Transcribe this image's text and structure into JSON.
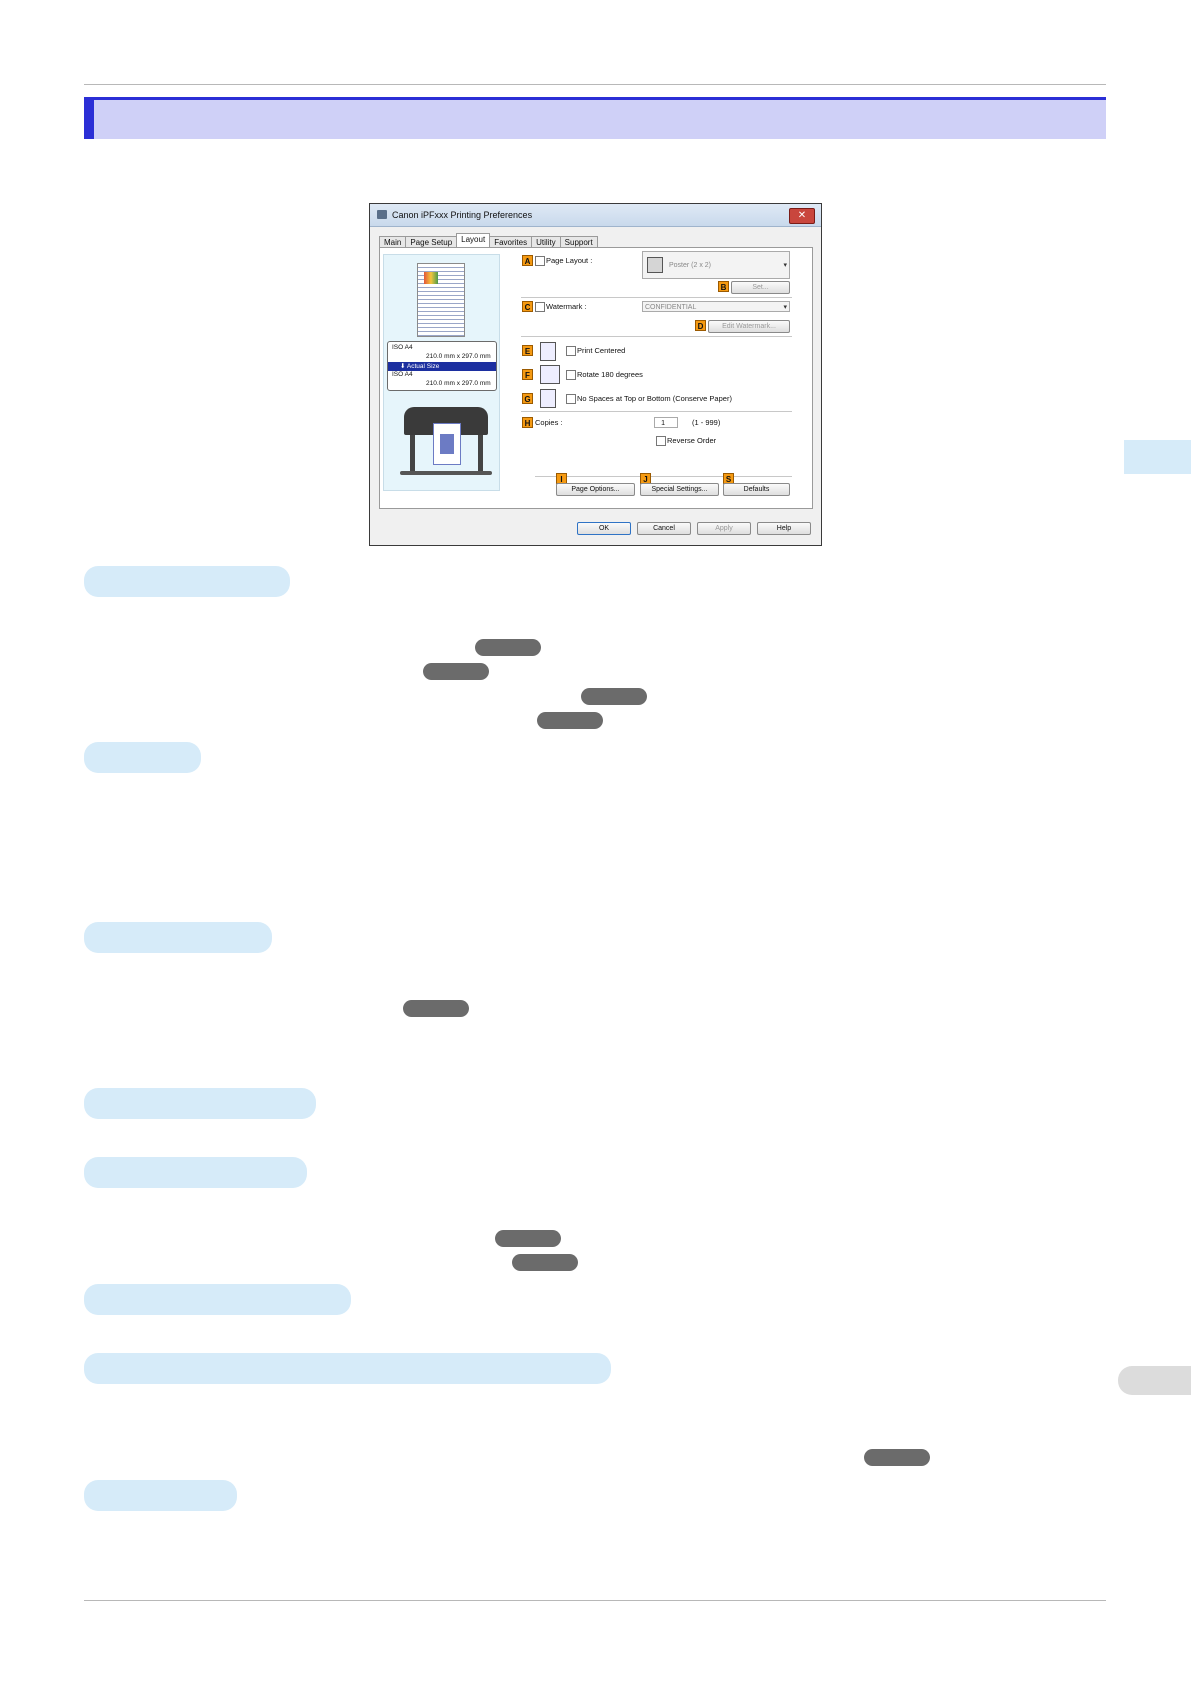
{
  "dialog": {
    "title": "Canon iPFxxx Printing Preferences",
    "close_label": "✕",
    "tabs": [
      "Main",
      "Page Setup",
      "Layout",
      "Favorites",
      "Utility",
      "Support"
    ],
    "active_tab": "Layout",
    "preview": {
      "size_line1": "ISO A4",
      "size_line2": "210.0 mm x 297.0 mm",
      "selected_label": "Actual Size",
      "size_line3": "ISO A4",
      "size_line4": "210.0 mm x 297.0 mm"
    },
    "badges": {
      "A": "A",
      "B": "B",
      "C": "C",
      "D": "D",
      "E": "E",
      "F": "F",
      "G": "G",
      "H": "H",
      "I": "I",
      "J": "J",
      "S": "S"
    },
    "page_layout": {
      "label": "Page Layout :",
      "value": "Poster (2 x 2)",
      "set_button": "Set..."
    },
    "watermark": {
      "label": "Watermark :",
      "value": "CONFIDENTIAL",
      "edit_button": "Edit Watermark..."
    },
    "print_centered": {
      "label": "Print Centered"
    },
    "rotate": {
      "label": "Rotate 180 degrees"
    },
    "no_spaces": {
      "label": "No Spaces at Top or Bottom (Conserve Paper)"
    },
    "copies": {
      "label": "Copies :",
      "value": "1",
      "range": "(1 - 999)",
      "reverse_label": "Reverse Order"
    },
    "buttons": {
      "page_options": "Page Options...",
      "special_settings": "Special Settings...",
      "defaults": "Defaults",
      "ok": "OK",
      "cancel": "Cancel",
      "apply": "Apply",
      "help": "Help"
    }
  }
}
